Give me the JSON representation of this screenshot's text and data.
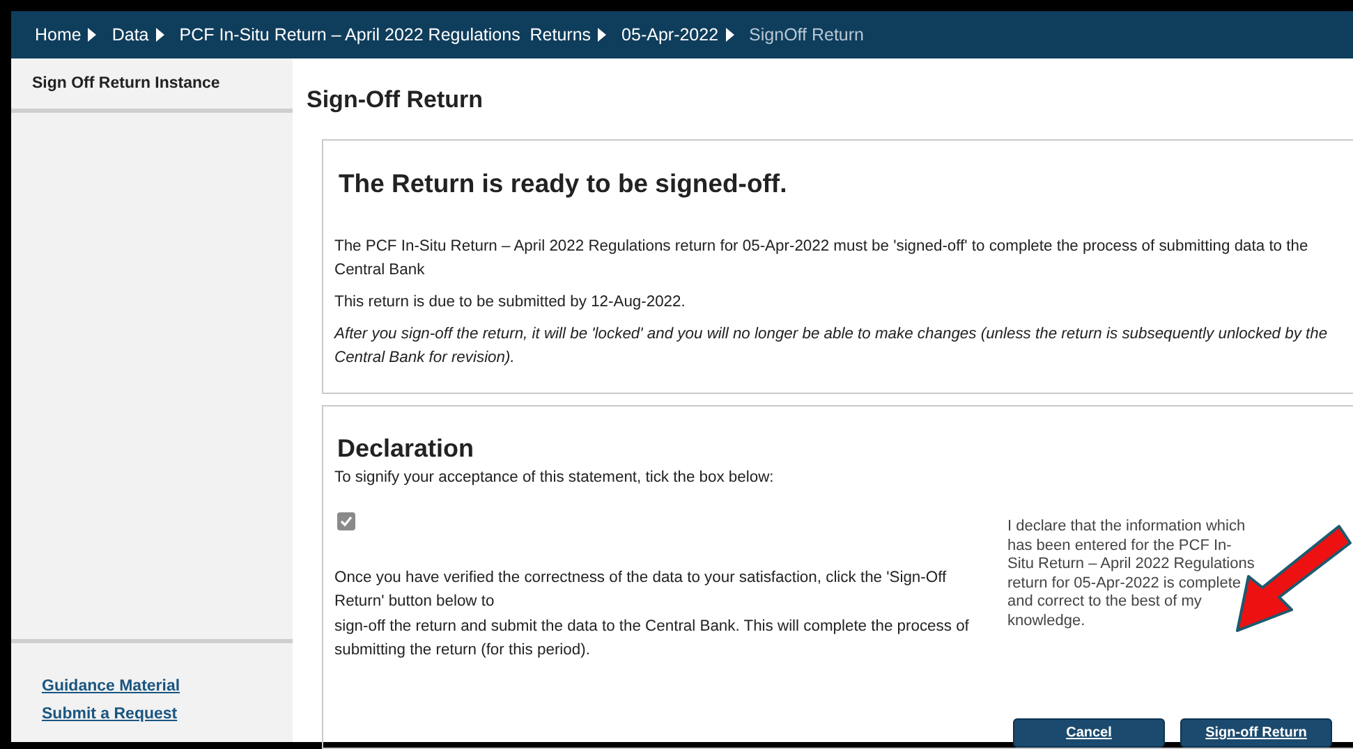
{
  "breadcrumb": [
    {
      "label": "Home",
      "current": false
    },
    {
      "label": "Data",
      "current": false
    },
    {
      "label": "PCF In-Situ Return – April 2022 Regulations  Returns",
      "current": false
    },
    {
      "label": "05-Apr-2022",
      "current": false
    },
    {
      "label": "SignOff Return",
      "current": true
    }
  ],
  "sidebar": {
    "items": [
      "Sign Off Return Instance"
    ],
    "links": [
      "Guidance Material",
      "Submit a Request"
    ]
  },
  "page_title": "Sign-Off Return",
  "status_panel": {
    "heading": "The Return is ready to be signed-off.",
    "paragraphs": [
      {
        "text": "The PCF In-Situ Return – April 2022 Regulations return for 05-Apr-2022 must be 'signed-off' to complete the process of submitting data to the Central Bank",
        "italic": false
      },
      {
        "text": "This return is due to be submitted by 12-Aug-2022.",
        "italic": false
      },
      {
        "text": "After you sign-off the return, it will be 'locked' and you will no longer be able to make changes (unless the return is subsequently unlocked by the Central Bank for revision).",
        "italic": true
      }
    ]
  },
  "declaration": {
    "heading": "Declaration",
    "instruction": "To signify your acceptance of this statement, tick the box below:",
    "checked": true,
    "explanation": [
      "Once you have verified the correctness of the data to your satisfaction, click the 'Sign-Off Return' button below to",
      "sign-off the return and submit the data to the Central Bank. This will complete the process of submitting the return (for this period)."
    ],
    "statement": "I declare that the information which has been entered for the PCF In-Situ Return – April 2022 Regulations return for 05-Apr-2022 is complete and correct to the best of my knowledge."
  },
  "buttons": [
    "Cancel",
    "Sign-off Return"
  ]
}
